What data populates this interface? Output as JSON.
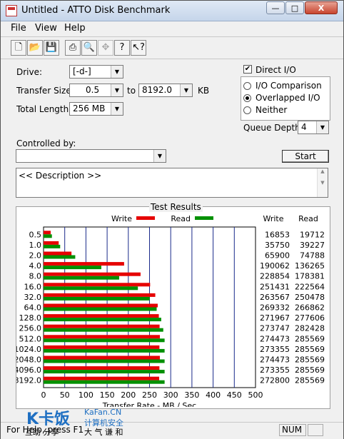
{
  "window": {
    "title": "Untitled - ATTO Disk Benchmark",
    "controls": {
      "minimize": "—",
      "maximize": "□",
      "close": "X"
    }
  },
  "menu": {
    "file": "File",
    "view": "View",
    "help": "Help"
  },
  "toolbar": {
    "icons": [
      "new-file-icon",
      "open-folder-icon",
      "save-icon",
      "print-icon",
      "print-preview-icon",
      "move-icon",
      "help-icon",
      "context-help-icon"
    ]
  },
  "settings": {
    "drive_label": "Drive:",
    "drive_value": "[-d-]",
    "transfer_size_label": "Transfer Size:",
    "transfer_from": "0.5",
    "to_label": "to",
    "transfer_to": "8192.0",
    "kb_label": "KB",
    "total_length_label": "Total Length:",
    "total_length_value": "256 MB",
    "controlled_by_label": "Controlled by:",
    "controlled_by_value": ""
  },
  "options": {
    "direct_io": "Direct I/O",
    "direct_io_checked": true,
    "io_comparison": "I/O Comparison",
    "overlapped_io": "Overlapped I/O",
    "neither": "Neither",
    "selected_mode": "overlapped_io",
    "queue_depth_label": "Queue Depth:",
    "queue_depth_value": "4"
  },
  "start_button": "Start",
  "description": "<< Description >>",
  "results": {
    "title": "Test Results",
    "legend_write": "Write",
    "legend_read": "Read",
    "col_write": "Write",
    "col_read": "Read",
    "write_color": "#e60000",
    "read_color": "#009000"
  },
  "chart_data": {
    "type": "bar",
    "xlabel": "Transfer Rate - MB / Sec",
    "xlim": [
      0,
      500
    ],
    "xticks": [
      "0",
      "50",
      "100",
      "150",
      "200",
      "250",
      "300",
      "350",
      "400",
      "450",
      "500"
    ],
    "categories": [
      "0.5",
      "1.0",
      "2.0",
      "4.0",
      "8.0",
      "16.0",
      "32.0",
      "64.0",
      "128.0",
      "256.0",
      "512.0",
      "1024.0",
      "2048.0",
      "4096.0",
      "8192.0"
    ],
    "series": [
      {
        "name": "Write",
        "values": [
          16.853,
          35.75,
          65.9,
          190.062,
          228.854,
          251.431,
          263.567,
          269.332,
          271.967,
          273.747,
          274.473,
          273.355,
          274.473,
          273.355,
          272.8
        ]
      },
      {
        "name": "Read",
        "values": [
          19.712,
          39.227,
          74.788,
          136.265,
          178.381,
          222.564,
          250.478,
          266.862,
          277.606,
          282.428,
          285.569,
          285.569,
          285.569,
          285.569,
          285.569
        ]
      }
    ],
    "write_kb": [
      "16853",
      "35750",
      "65900",
      "190062",
      "228854",
      "251431",
      "263567",
      "269332",
      "271967",
      "273747",
      "274473",
      "273355",
      "274473",
      "273355",
      "272800"
    ],
    "read_kb": [
      "19712",
      "39227",
      "74788",
      "136265",
      "178381",
      "222564",
      "250478",
      "266862",
      "277606",
      "282428",
      "285569",
      "285569",
      "285569",
      "285569",
      "285569"
    ]
  },
  "statusbar": {
    "hint": "For Help, press F1",
    "num": "NUM"
  },
  "watermark": {
    "logo": "K卡饭",
    "site": "KaFan.CN",
    "tagline1": "计算机安全",
    "tagline2": "互助 分享",
    "tagline3": "大 气 谦 和"
  }
}
